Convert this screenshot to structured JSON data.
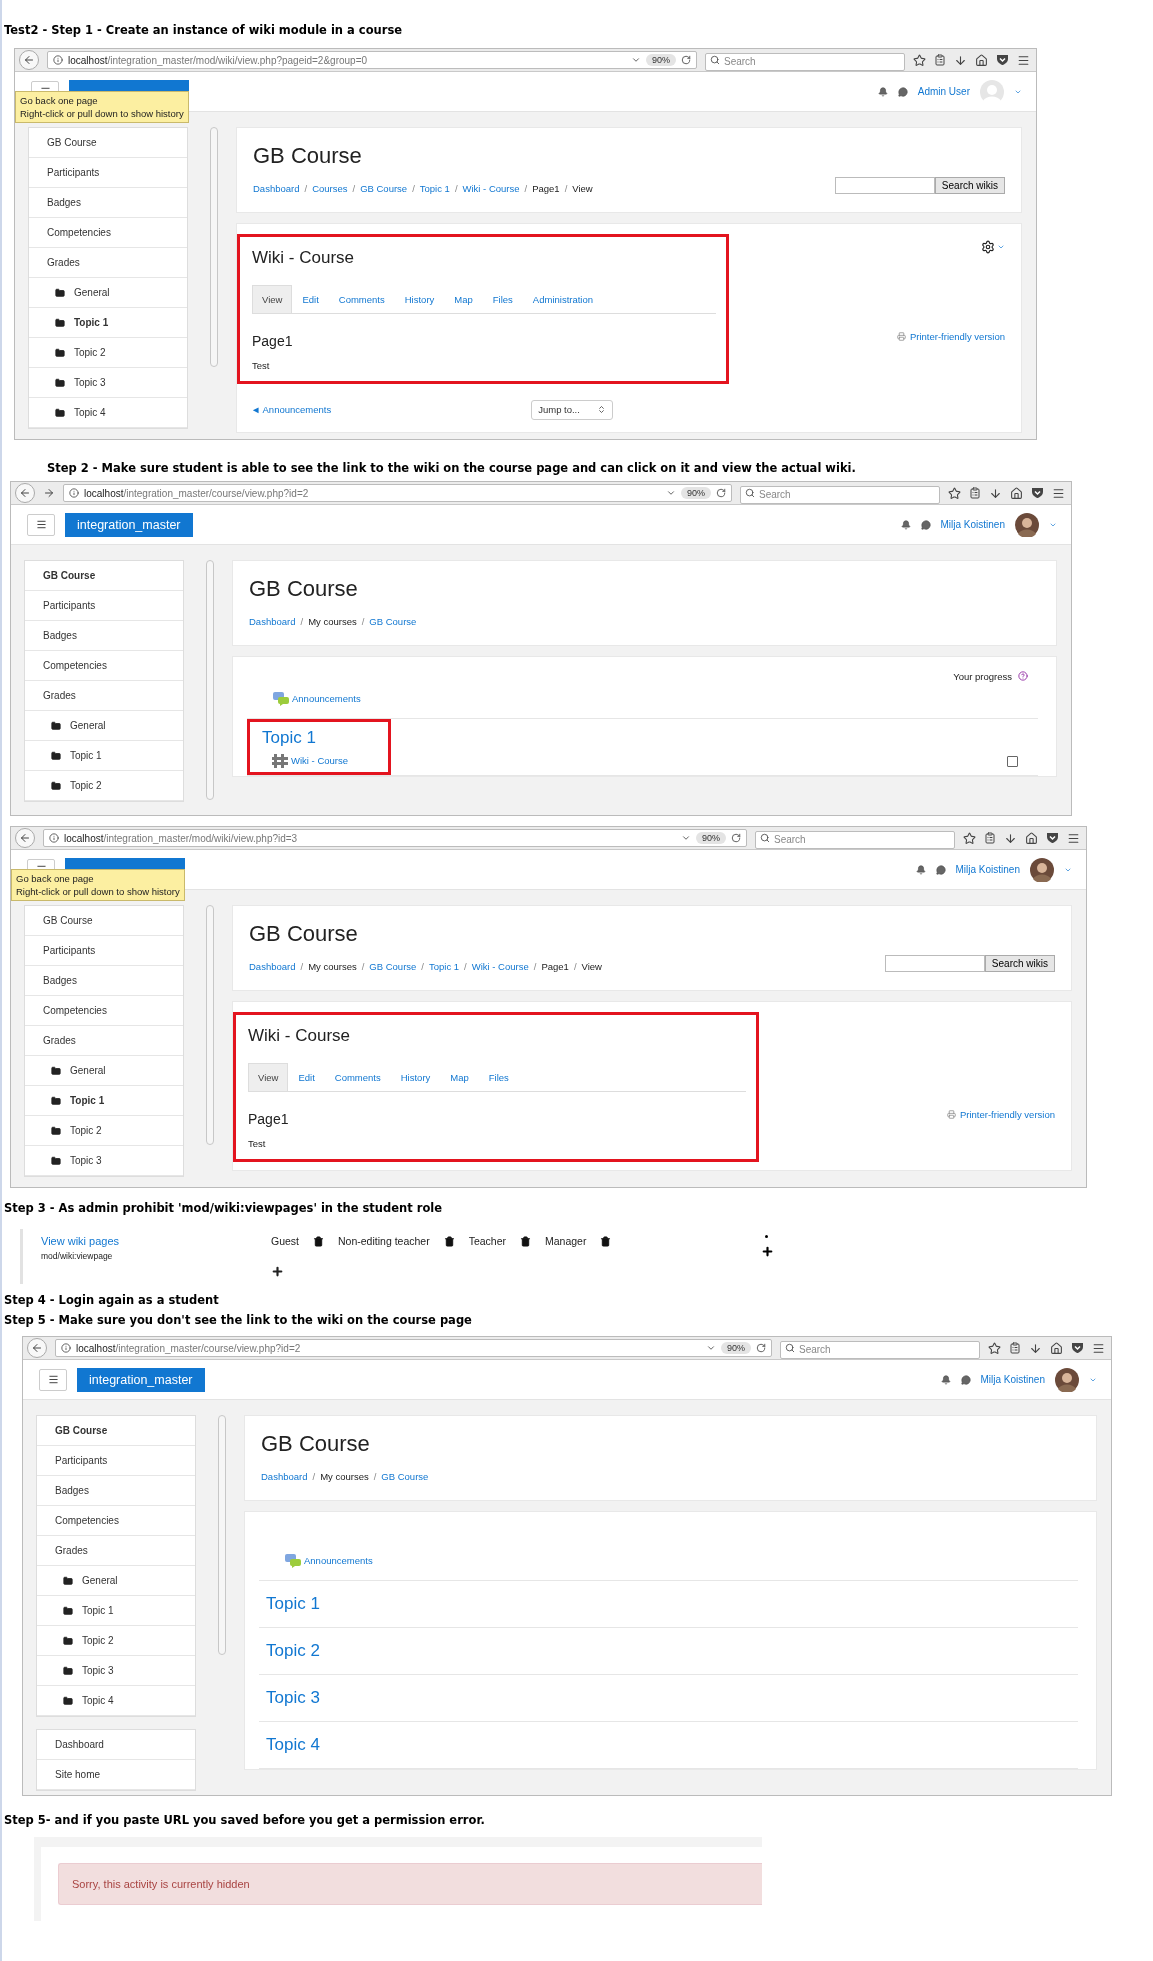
{
  "sections": [
    {
      "kind": "heading",
      "text": "Test2 - Step 1 - Create an instance of wiki module in a course"
    },
    {
      "kind": "browser",
      "forward": false,
      "url": "localhost/integration_master/mod/wiki/view.php?pageid=2&group=0",
      "zoom": "90%",
      "search_placeholder": "Search",
      "tooltip": [
        "Go back one page",
        "Right-click or pull down to show history"
      ],
      "user": "Admin User",
      "avatar": {
        "kind": "blank"
      },
      "sidebar": [
        [
          {
            "label": "GB Course",
            "current": false,
            "folder": false
          },
          {
            "label": "Participants",
            "current": false,
            "folder": false
          },
          {
            "label": "Badges",
            "current": false,
            "folder": false
          },
          {
            "label": "Competencies",
            "current": false,
            "folder": false
          },
          {
            "label": "Grades",
            "current": false,
            "folder": false
          },
          {
            "label": "General",
            "current": false,
            "folder": true
          },
          {
            "label": "Topic 1",
            "current": true,
            "folder": true
          },
          {
            "label": "Topic 2",
            "current": false,
            "folder": true
          },
          {
            "label": "Topic 3",
            "current": false,
            "folder": true
          },
          {
            "label": "Topic 4",
            "current": false,
            "folder": true
          }
        ]
      ],
      "header_card": {
        "title": "GB Course",
        "separator": "/",
        "search_button": "Search wikis",
        "breadcrumbs": [
          {
            "text": "Dashboard",
            "link": true
          },
          {
            "text": "Courses",
            "link": true
          },
          {
            "text": "GB Course",
            "link": true
          },
          {
            "text": "Topic 1",
            "link": true
          },
          {
            "text": "Wiki - Course",
            "link": true
          },
          {
            "text": "Page1",
            "link": false
          },
          {
            "text": "View",
            "link": false
          }
        ]
      },
      "content": {
        "kind": "wiki",
        "title": "Wiki - Course",
        "highlighted": true,
        "settings": true,
        "printer_link": "Printer-friendly version",
        "page_title": "Page1",
        "body": "Test",
        "prev_link": "◄ Announcements",
        "jump": "Jump to...",
        "tabs": [
          {
            "label": "View",
            "selected": true
          },
          {
            "label": "Edit",
            "selected": false
          },
          {
            "label": "Comments",
            "selected": false
          },
          {
            "label": "History",
            "selected": false
          },
          {
            "label": "Map",
            "selected": false
          },
          {
            "label": "Files",
            "selected": false
          },
          {
            "label": "Administration",
            "selected": false
          }
        ]
      }
    },
    {
      "kind": "heading",
      "text": "Step 2 - Make sure student is able to see the link to the wiki on the course page and can click on it and view the actual wiki."
    },
    {
      "kind": "browser",
      "forward": true,
      "url": "localhost/integration_master/course/view.php?id=2",
      "zoom": "90%",
      "search_placeholder": "Search",
      "brand": "integration_master",
      "user": "Milja Koistinen",
      "avatar": {
        "kind": "photo"
      },
      "sidebar": [
        [
          {
            "label": "GB Course",
            "current": true,
            "folder": false
          },
          {
            "label": "Participants",
            "current": false,
            "folder": false
          },
          {
            "label": "Badges",
            "current": false,
            "folder": false
          },
          {
            "label": "Competencies",
            "current": false,
            "folder": false
          },
          {
            "label": "Grades",
            "current": false,
            "folder": false
          },
          {
            "label": "General",
            "current": false,
            "folder": true
          },
          {
            "label": "Topic 1",
            "current": false,
            "folder": true
          },
          {
            "label": "Topic 2",
            "current": false,
            "folder": true
          }
        ]
      ],
      "header_card": {
        "title": "GB Course",
        "separator": "/",
        "breadcrumbs": [
          {
            "text": "Dashboard",
            "link": true
          },
          {
            "text": "My courses",
            "link": false
          },
          {
            "text": "GB Course",
            "link": true
          }
        ]
      },
      "content": {
        "kind": "course",
        "progress": "Your progress",
        "announcements": "Announcements",
        "sections": [
          {
            "title": "Topic 1",
            "highlighted": true,
            "activities": [
              {
                "label": "Wiki - Course",
                "checked": false
              }
            ]
          }
        ]
      }
    },
    {
      "kind": "browser",
      "forward": false,
      "url": "localhost/integration_master/mod/wiki/view.php?id=3",
      "zoom": "90%",
      "search_placeholder": "Search",
      "tooltip": [
        "Go back one page",
        "Right-click or pull down to show history"
      ],
      "user": "Milja Koistinen",
      "avatar": {
        "kind": "photo"
      },
      "sidebar": [
        [
          {
            "label": "GB Course",
            "current": false,
            "folder": false
          },
          {
            "label": "Participants",
            "current": false,
            "folder": false
          },
          {
            "label": "Badges",
            "current": false,
            "folder": false
          },
          {
            "label": "Competencies",
            "current": false,
            "folder": false
          },
          {
            "label": "Grades",
            "current": false,
            "folder": false
          },
          {
            "label": "General",
            "current": false,
            "folder": true
          },
          {
            "label": "Topic 1",
            "current": true,
            "folder": true
          },
          {
            "label": "Topic 2",
            "current": false,
            "folder": true
          },
          {
            "label": "Topic 3",
            "current": false,
            "folder": true
          }
        ]
      ],
      "header_card": {
        "title": "GB Course",
        "separator": "/",
        "search_button": "Search wikis",
        "breadcrumbs": [
          {
            "text": "Dashboard",
            "link": true
          },
          {
            "text": "My courses",
            "link": false
          },
          {
            "text": "GB Course",
            "link": true
          },
          {
            "text": "Topic 1",
            "link": true
          },
          {
            "text": "Wiki - Course",
            "link": true
          },
          {
            "text": "Page1",
            "link": false
          },
          {
            "text": "View",
            "link": false
          }
        ]
      },
      "content": {
        "kind": "wiki",
        "title": "Wiki - Course",
        "highlighted": true,
        "settings": false,
        "printer_link": "Printer-friendly version",
        "page_title": "Page1",
        "body": "Test",
        "tabs": [
          {
            "label": "View",
            "selected": true
          },
          {
            "label": "Edit",
            "selected": false
          },
          {
            "label": "Comments",
            "selected": false
          },
          {
            "label": "History",
            "selected": false
          },
          {
            "label": "Map",
            "selected": false
          },
          {
            "label": "Files",
            "selected": false
          }
        ]
      }
    },
    {
      "kind": "heading",
      "text": "Step 3 - As admin prohibit 'mod/wiki:viewpages' in the student role"
    },
    {
      "kind": "permission",
      "name": "View wiki pages",
      "capability": "mod/wiki:viewpage",
      "roles": [
        "Guest",
        "Non-editing teacher",
        "Teacher",
        "Manager"
      ]
    },
    {
      "kind": "heading",
      "text": "Step 4 - Login again as a student"
    },
    {
      "kind": "heading",
      "text": "Step 5 - Make sure you don't see the link to the wiki on the course page"
    },
    {
      "kind": "browser",
      "forward": false,
      "url": "localhost/integration_master/course/view.php?id=2",
      "zoom": "90%",
      "search_placeholder": "Search",
      "brand": "integration_master",
      "user": "Milja Koistinen",
      "avatar": {
        "kind": "photo"
      },
      "sidebar": [
        [
          {
            "label": "GB Course",
            "current": true,
            "folder": false
          },
          {
            "label": "Participants",
            "current": false,
            "folder": false
          },
          {
            "label": "Badges",
            "current": false,
            "folder": false
          },
          {
            "label": "Competencies",
            "current": false,
            "folder": false
          },
          {
            "label": "Grades",
            "current": false,
            "folder": false
          },
          {
            "label": "General",
            "current": false,
            "folder": true
          },
          {
            "label": "Topic 1",
            "current": false,
            "folder": true
          },
          {
            "label": "Topic 2",
            "current": false,
            "folder": true
          },
          {
            "label": "Topic 3",
            "current": false,
            "folder": true
          },
          {
            "label": "Topic 4",
            "current": false,
            "folder": true
          }
        ],
        [
          {
            "label": "Dashboard",
            "current": false,
            "folder": false
          },
          {
            "label": "Site home",
            "current": false,
            "folder": false
          }
        ]
      ],
      "header_card": {
        "title": "GB Course",
        "separator": "/",
        "breadcrumbs": [
          {
            "text": "Dashboard",
            "link": true
          },
          {
            "text": "My courses",
            "link": false
          },
          {
            "text": "GB Course",
            "link": true
          }
        ]
      },
      "content": {
        "kind": "course",
        "announcements": "Announcements",
        "sections": [
          {
            "title": "Topic 1",
            "highlighted": false
          },
          {
            "title": "Topic 2",
            "highlighted": false
          },
          {
            "title": "Topic 3",
            "highlighted": false
          },
          {
            "title": "Topic 4",
            "highlighted": false
          }
        ]
      }
    },
    {
      "kind": "heading",
      "text": "Step 5- and if you paste URL you saved before you get a permission error."
    },
    {
      "kind": "alert",
      "text": "Sorry, this activity is currently hidden"
    }
  ]
}
